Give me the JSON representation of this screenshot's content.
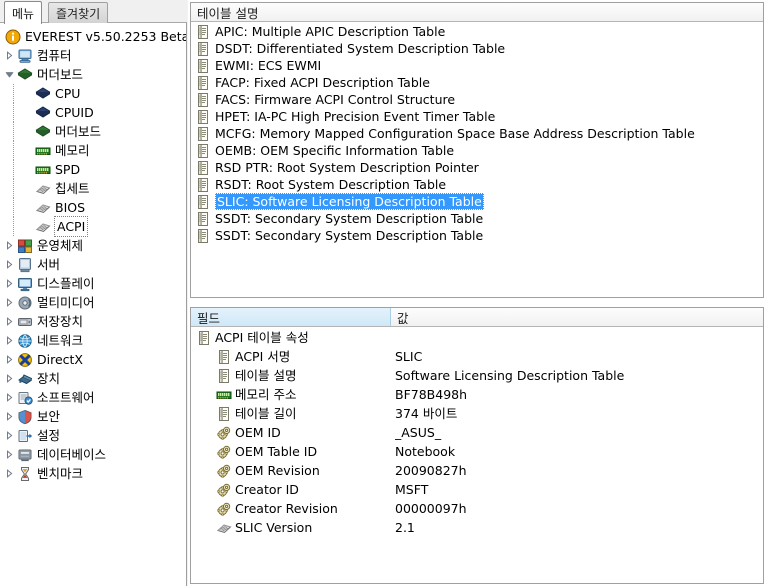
{
  "app": {
    "title": "EVEREST v5.50.2253 Beta"
  },
  "tabs": [
    {
      "label": "메뉴",
      "active": true
    },
    {
      "label": "즐겨찾기",
      "active": false
    }
  ],
  "tree": {
    "root_label": "EVEREST v5.50.2253 Beta",
    "root_icon": "info-icon",
    "items": [
      {
        "label": "컴퓨터",
        "icon": "computer-icon",
        "level": 1,
        "expander": "collapsed",
        "selected": false
      },
      {
        "label": "머더보드",
        "icon": "motherboard-icon",
        "level": 1,
        "expander": "expanded",
        "selected": false
      },
      {
        "label": "CPU",
        "icon": "cpu-icon",
        "level": 2,
        "expander": "none",
        "selected": false
      },
      {
        "label": "CPUID",
        "icon": "cpu-icon",
        "level": 2,
        "expander": "none",
        "selected": false
      },
      {
        "label": "머더보드",
        "icon": "motherboard-icon",
        "level": 2,
        "expander": "none",
        "selected": false
      },
      {
        "label": "메모리",
        "icon": "memory-icon",
        "level": 2,
        "expander": "none",
        "selected": false
      },
      {
        "label": "SPD",
        "icon": "memory-icon",
        "level": 2,
        "expander": "none",
        "selected": false
      },
      {
        "label": "칩세트",
        "icon": "chip-icon",
        "level": 2,
        "expander": "none",
        "selected": false
      },
      {
        "label": "BIOS",
        "icon": "chip-icon",
        "level": 2,
        "expander": "none",
        "selected": false
      },
      {
        "label": "ACPI",
        "icon": "chip-icon",
        "level": 2,
        "expander": "none",
        "selected": true
      },
      {
        "label": "운영체제",
        "icon": "os-icon",
        "level": 1,
        "expander": "collapsed",
        "selected": false
      },
      {
        "label": "서버",
        "icon": "server-icon",
        "level": 1,
        "expander": "collapsed",
        "selected": false
      },
      {
        "label": "디스플레이",
        "icon": "display-icon",
        "level": 1,
        "expander": "collapsed",
        "selected": false
      },
      {
        "label": "멀티미디어",
        "icon": "multimedia-icon",
        "level": 1,
        "expander": "collapsed",
        "selected": false
      },
      {
        "label": "저장장치",
        "icon": "storage-icon",
        "level": 1,
        "expander": "collapsed",
        "selected": false
      },
      {
        "label": "네트워크",
        "icon": "network-icon",
        "level": 1,
        "expander": "collapsed",
        "selected": false
      },
      {
        "label": "DirectX",
        "icon": "directx-icon",
        "level": 1,
        "expander": "collapsed",
        "selected": false
      },
      {
        "label": "장치",
        "icon": "device-icon",
        "level": 1,
        "expander": "collapsed",
        "selected": false
      },
      {
        "label": "소프트웨어",
        "icon": "software-icon",
        "level": 1,
        "expander": "collapsed",
        "selected": false
      },
      {
        "label": "보안",
        "icon": "security-icon",
        "level": 1,
        "expander": "collapsed",
        "selected": false
      },
      {
        "label": "설정",
        "icon": "config-icon",
        "level": 1,
        "expander": "collapsed",
        "selected": false
      },
      {
        "label": "데이터베이스",
        "icon": "database-icon",
        "level": 1,
        "expander": "collapsed",
        "selected": false
      },
      {
        "label": "벤치마크",
        "icon": "benchmark-icon",
        "level": 1,
        "expander": "collapsed",
        "selected": false
      }
    ]
  },
  "table_list": {
    "column_header": "테이블 설명",
    "rows": [
      {
        "text": "APIC: Multiple APIC Description Table",
        "selected": false
      },
      {
        "text": "DSDT: Differentiated System Description Table",
        "selected": false
      },
      {
        "text": "EWMI: ECS EWMI",
        "selected": false
      },
      {
        "text": "FACP: Fixed ACPI Description Table",
        "selected": false
      },
      {
        "text": "FACS: Firmware ACPI Control Structure",
        "selected": false
      },
      {
        "text": "HPET: IA-PC High Precision Event Timer Table",
        "selected": false
      },
      {
        "text": "MCFG: Memory Mapped Configuration Space Base Address Description Table",
        "selected": false
      },
      {
        "text": "OEMB: OEM Specific Information Table",
        "selected": false
      },
      {
        "text": "RSD PTR: Root System Description Pointer",
        "selected": false
      },
      {
        "text": "RSDT: Root System Description Table",
        "selected": false
      },
      {
        "text": "SLIC: Software Licensing Description Table",
        "selected": true
      },
      {
        "text": "SSDT: Secondary System Description Table",
        "selected": false
      },
      {
        "text": "SSDT: Secondary System Description Table",
        "selected": false
      }
    ]
  },
  "details": {
    "columns": [
      {
        "label": "필드",
        "highlighted": true
      },
      {
        "label": "값",
        "highlighted": false
      }
    ],
    "rows": [
      {
        "field": "ACPI 테이블 속성",
        "value": "",
        "icon": "table-icon",
        "level": 0
      },
      {
        "field": "ACPI 서명",
        "value": "SLIC",
        "icon": "table-icon",
        "level": 1
      },
      {
        "field": "테이블 설명",
        "value": "Software Licensing Description Table",
        "icon": "table-icon",
        "level": 1
      },
      {
        "field": "메모리 주소",
        "value": "BF78B498h",
        "icon": "memory-icon",
        "level": 1
      },
      {
        "field": "테이블 길이",
        "value": "374 바이트",
        "icon": "table-icon",
        "level": 1
      },
      {
        "field": "OEM ID",
        "value": "_ASUS_",
        "icon": "gear-icon",
        "level": 1
      },
      {
        "field": "OEM Table ID",
        "value": "Notebook",
        "icon": "gear-icon",
        "level": 1
      },
      {
        "field": "OEM Revision",
        "value": "20090827h",
        "icon": "gear-icon",
        "level": 1
      },
      {
        "field": "Creator ID",
        "value": "MSFT",
        "icon": "gear-icon",
        "level": 1
      },
      {
        "field": "Creator Revision",
        "value": "00000097h",
        "icon": "gear-icon",
        "level": 1
      },
      {
        "field": "SLIC Version",
        "value": "2.1",
        "icon": "chip-icon",
        "level": 1
      }
    ]
  },
  "colors": {
    "selection": "#3399ff",
    "header_highlight": "#cfe8f7",
    "panel_border": "#a0a0a0"
  }
}
